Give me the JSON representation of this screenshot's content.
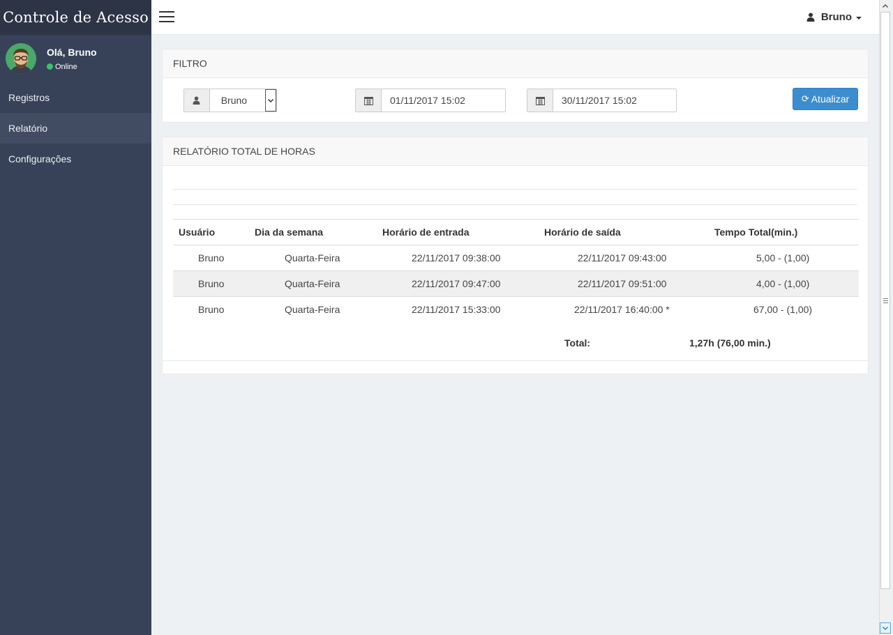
{
  "app": {
    "title": "Controle de Acesso"
  },
  "user": {
    "greeting": "Olá, Bruno",
    "status": "Online",
    "name": "Bruno"
  },
  "nav": {
    "items": [
      {
        "label": "Registros",
        "active": false
      },
      {
        "label": "Relatório",
        "active": true
      },
      {
        "label": "Configurações",
        "active": false
      }
    ]
  },
  "filter": {
    "heading": "FILTRO",
    "user_select": "Bruno",
    "date_start": "01/11/2017 15:02",
    "date_end": "30/11/2017 15:02",
    "refresh_label": "Atualizar"
  },
  "report": {
    "heading": "RELATÓRIO TOTAL DE HORAS",
    "columns": [
      "Usuário",
      "Dia da semana",
      "Horário de entrada",
      "Horário de saída",
      "Tempo Total(min.)"
    ],
    "rows": [
      [
        "Bruno",
        "Quarta-Feira",
        "22/11/2017 09:38:00",
        "22/11/2017 09:43:00",
        "5,00 - (1,00)"
      ],
      [
        "Bruno",
        "Quarta-Feira",
        "22/11/2017 09:47:00",
        "22/11/2017 09:51:00",
        "4,00 - (1,00)"
      ],
      [
        "Bruno",
        "Quarta-Feira",
        "22/11/2017 15:33:00",
        "22/11/2017 16:40:00 *",
        "67,00 - (1,00)"
      ]
    ],
    "total_label": "Total:",
    "total_value": "1,27h (76,00 min.)"
  },
  "colors": {
    "sidebar": "#374258",
    "brand_bar": "#2d3446",
    "accent": "#3c8dd0",
    "online": "#3cc36a"
  }
}
